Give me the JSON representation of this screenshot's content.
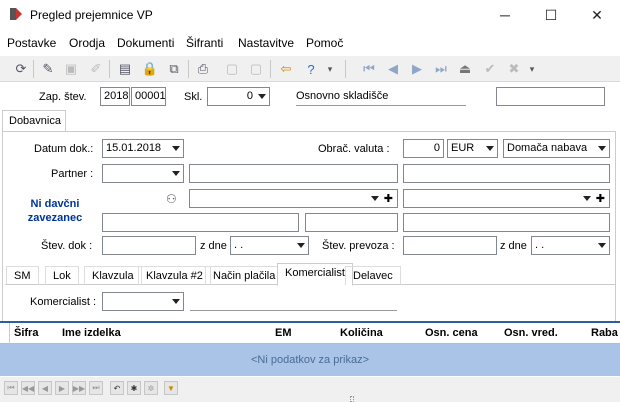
{
  "window": {
    "title": "Pregled prejemnice VP",
    "minimize": "─",
    "maximize": "☐",
    "close": "✕"
  },
  "menu": [
    "Postavke",
    "Orodja",
    "Dokumenti",
    "Šifranti",
    "Nastavitve",
    "Pomoč"
  ],
  "toolbar": {
    "more": "▾"
  },
  "header": {
    "zap_label": "Zap. štev.",
    "year": "2018",
    "number": "00001",
    "skl_label": "Skl.",
    "skl_value": "0",
    "warehouse": "Osnovno skladišče"
  },
  "main_tab": "Dobavnica",
  "form": {
    "datum_label": "Datum dok.:",
    "datum_value": "15.01.2018",
    "valuta_label": "Obrač. valuta :",
    "valuta_num": "0",
    "valuta_code": "EUR",
    "nabava": "Domača nabava",
    "partner_label": "Partner :",
    "ni_davcni": "Ni davčni zavezanec",
    "stev_dok_label": "Štev. dok :",
    "z_dne_label": "z dne",
    "date_empty": ". .",
    "stev_prevoza_label": "Štev. prevoza :",
    "z_dne2_label": "z dne"
  },
  "sub_tabs": [
    "SM",
    "Lok",
    "Klavzula",
    "Klavzula #2",
    "Način plačila",
    "Komercialist",
    "Delavec"
  ],
  "active_sub_tab": "Komercialist",
  "komercialist_label": "Komercialist :",
  "grid": {
    "columns": [
      "Šifra",
      "Ime izdelka",
      "EM",
      "Količina",
      "Osn. cena",
      "Osn. vred.",
      "Raba"
    ],
    "empty": "<Ni podatkov za prikaz>"
  },
  "nav": [
    "⏮",
    "◀◀",
    "◀",
    "▶",
    "▶▶",
    "⏭",
    "↶",
    "✱",
    "✲",
    "▼"
  ],
  "colors": {
    "grid_empty": "#a9c4e6",
    "accent": "#003399"
  }
}
